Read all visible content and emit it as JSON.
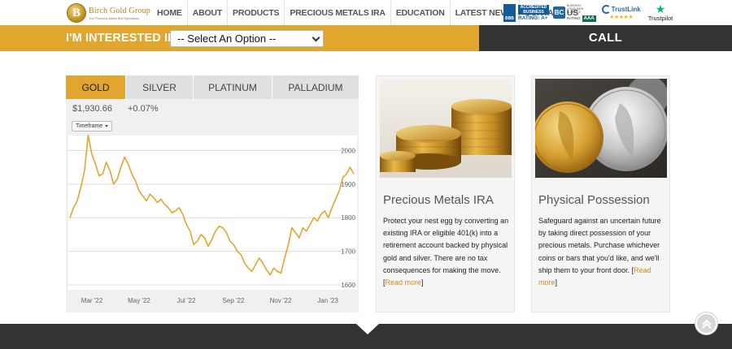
{
  "brand": {
    "name": "Birch Gold Group",
    "tagline": "The Precious Metal IRA Specialists",
    "logo_letter": "B"
  },
  "nav": {
    "items": [
      "HOME",
      "ABOUT",
      "PRODUCTS",
      "PRECIOUS METALS IRA",
      "EDUCATION",
      "LATEST NEWS",
      "CONTACT US"
    ]
  },
  "badges": {
    "bbb": {
      "seal": "BBB",
      "accredited": "ACCREDITED BUSINESS",
      "rating": "RATING: A+"
    },
    "bca": {
      "logo": "BC",
      "small": "BUSINESS CONSUMER ALLIANCE",
      "rating_label": "RATING",
      "rating": "AAA"
    },
    "trustlink": {
      "name": "TrustLink",
      "stars": "★★★★★"
    },
    "trustpilot": {
      "star": "★",
      "name": "Trustpilot"
    }
  },
  "interest": {
    "label": "I'M INTERESTED IN >",
    "select_value": "-- Select An Option --",
    "call_label": "CALL"
  },
  "widget": {
    "tabs": [
      "GOLD",
      "SILVER",
      "PLATINUM",
      "PALLADIUM"
    ],
    "active_tab": "GOLD",
    "price": "$1,930.66",
    "change": "+0.07%",
    "timeframe_label": "Timeframe"
  },
  "chart_data": {
    "type": "line",
    "title": "",
    "xlabel": "",
    "ylabel": "",
    "x_ticks": [
      "Mar '22",
      "May '22",
      "Jul '22",
      "Sep '22",
      "Nov '22",
      "Jan '23"
    ],
    "y_ticks": [
      1600,
      1700,
      1800,
      1900,
      2000
    ],
    "ylim": [
      1600,
      2030
    ],
    "grid": true,
    "series": [
      {
        "color": "#e2a62e",
        "values": [
          1800,
          1830,
          1850,
          1890,
          1940,
          2050,
          1990,
          1960,
          1925,
          1930,
          1965,
          1940,
          1900,
          1915,
          1950,
          1980,
          1960,
          1930,
          1910,
          1880,
          1865,
          1850,
          1870,
          1860,
          1845,
          1855,
          1840,
          1830,
          1815,
          1820,
          1830,
          1810,
          1780,
          1760,
          1720,
          1730,
          1750,
          1740,
          1715,
          1735,
          1760,
          1775,
          1770,
          1755,
          1730,
          1720,
          1700,
          1690,
          1665,
          1650,
          1640,
          1660,
          1680,
          1665,
          1645,
          1630,
          1650,
          1640,
          1635,
          1680,
          1720,
          1770,
          1755,
          1740,
          1770,
          1760,
          1780,
          1800,
          1790,
          1810,
          1820,
          1800,
          1830,
          1855,
          1880,
          1920,
          1930,
          1950,
          1930
        ]
      }
    ]
  },
  "cards": [
    {
      "title": "Precious Metals IRA",
      "body": "Protect your nest egg by converting an existing IRA or eligible 401(k) into a retirement account backed by physical gold and silver. There are no tax consequences for making the move.",
      "link_open": "[",
      "link": "Read more",
      "link_close": "]"
    },
    {
      "title": "Physical Possession",
      "body": "Safeguard against an uncertain future by taking direct possession of your precious metals. Purchase whichever coins or bars that you'd like, and we'll ship them to your front door.",
      "link_open": " [",
      "link": "Read more",
      "link_close": "]"
    }
  ]
}
